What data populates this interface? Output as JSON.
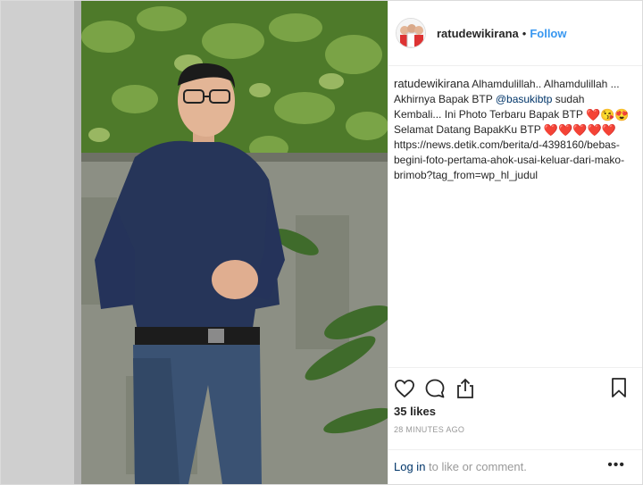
{
  "header": {
    "username": "ratudewikirana",
    "separator": "•",
    "follow_label": "Follow",
    "avatar_icon": "avatar-photo-icon"
  },
  "caption": {
    "username": "ratudewikirana",
    "line1": " Alhamdulillah.. Alhamdulillah ... Akhirnya Bapak BTP ",
    "mention": "@basukibtp",
    "line2": " sudah Kembali... Ini Photo Terbaru Bapak BTP ",
    "emoji_a": "❤️😘😍",
    "line3": "Selamat Datang BapakKu BTP ",
    "emoji_b": "❤️❤️❤️❤️❤️",
    "url": "https://news.detik.com/berita/d-4398160/bebas-begini-foto-pertama-ahok-usai-keluar-dari-mako-brimob?tag_from=wp_hl_judul"
  },
  "actions": {
    "like_icon": "heart-outline-icon",
    "comment_icon": "comment-icon",
    "share_icon": "share-icon",
    "save_icon": "bookmark-icon"
  },
  "likes": "35 likes",
  "timestamp": "28 MINUTES AGO",
  "comment": {
    "login_label": "Log in",
    "rest_label": " to like or comment.",
    "more_label": "•••"
  },
  "colors": {
    "link": "#003569",
    "follow": "#3897f0",
    "text": "#262626",
    "muted": "#999999"
  }
}
